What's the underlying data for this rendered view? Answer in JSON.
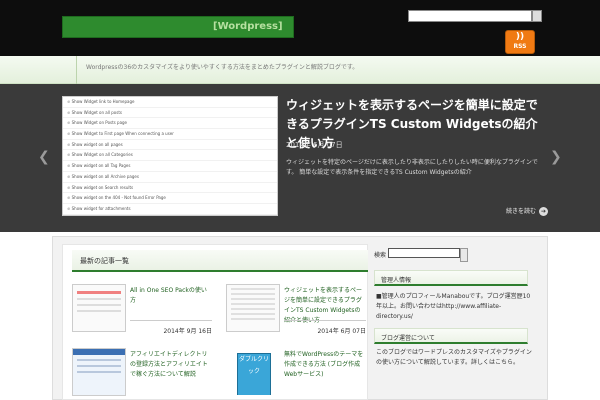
{
  "header": {
    "logo_text": "WordPress",
    "logo_suffix": "[Wordpress]",
    "rss_label": "RSS",
    "tagline": "Wordpressの36のカスタマイズをより使いやすくする方法をまとめたプラグインと解説ブログです。"
  },
  "slider": {
    "title": "ウィジェットを表示するページを簡単に設定できるプラグインTS Custom Widgetsの紹介と使い方",
    "date": "2014年 6月 07日",
    "text": "ウィジェットを特定のページだけに表示したり非表示にしたりしたい時に便利なプラグインです。 簡単な設定で表示条件を指定できるTS Custom Widgetsの紹介",
    "more_label": "続きを読む",
    "image_rows": [
      "Show Widget link to Homepage",
      "Show Widget on all posts",
      "Show Widget on Posts page",
      "Show Widget to First page When connecting a user",
      "Show widget on all pages",
      "Show Widget on all Categories",
      "Show widget on all Tag Pages",
      "Show widget on all Archive pages",
      "Show widget on Search results",
      "Show widget on the 404 - Not found Error Page",
      "Show widget for attachments"
    ]
  },
  "main": {
    "section_title": "最新の記事一覧",
    "posts": [
      {
        "title": "All in One SEO Packの使い方",
        "date": "2014年 9月 16日"
      },
      {
        "title": "ウィジェットを表示するページを簡単に設定できるプラグインTS Custom Widgetsの紹介と使い方",
        "date": "2014年 6月 07日"
      },
      {
        "title": "アフィリエイトディレクトリの登録方法とアフィリエイトで稼ぐ方法について解説",
        "date": ""
      },
      {
        "title": "無料でWordPressのテーマを作成できる方法 (ブログ作成Webサービス)",
        "date": ""
      }
    ],
    "thumb4_label": "ダブルクリック"
  },
  "sidebar": {
    "search_label": "検索",
    "widget1_title": "管理人情報",
    "widget1_text": "■管理人のプロフィールManabouです。ブログ運営歴10年以上。お問い合わせはhttp://www.affiliate-directory.us/",
    "widget2_title": "ブログ運営について",
    "widget2_text": "このブログではワードプレスのカスタマイズやプラグインの使い方について解説しています。詳しくはこちら。"
  },
  "colors": {
    "brand_green": "#2e7d2e",
    "header_bg": "#0d0d0d",
    "slider_bg": "#3a3a3a",
    "rss_orange": "#f07a13"
  }
}
